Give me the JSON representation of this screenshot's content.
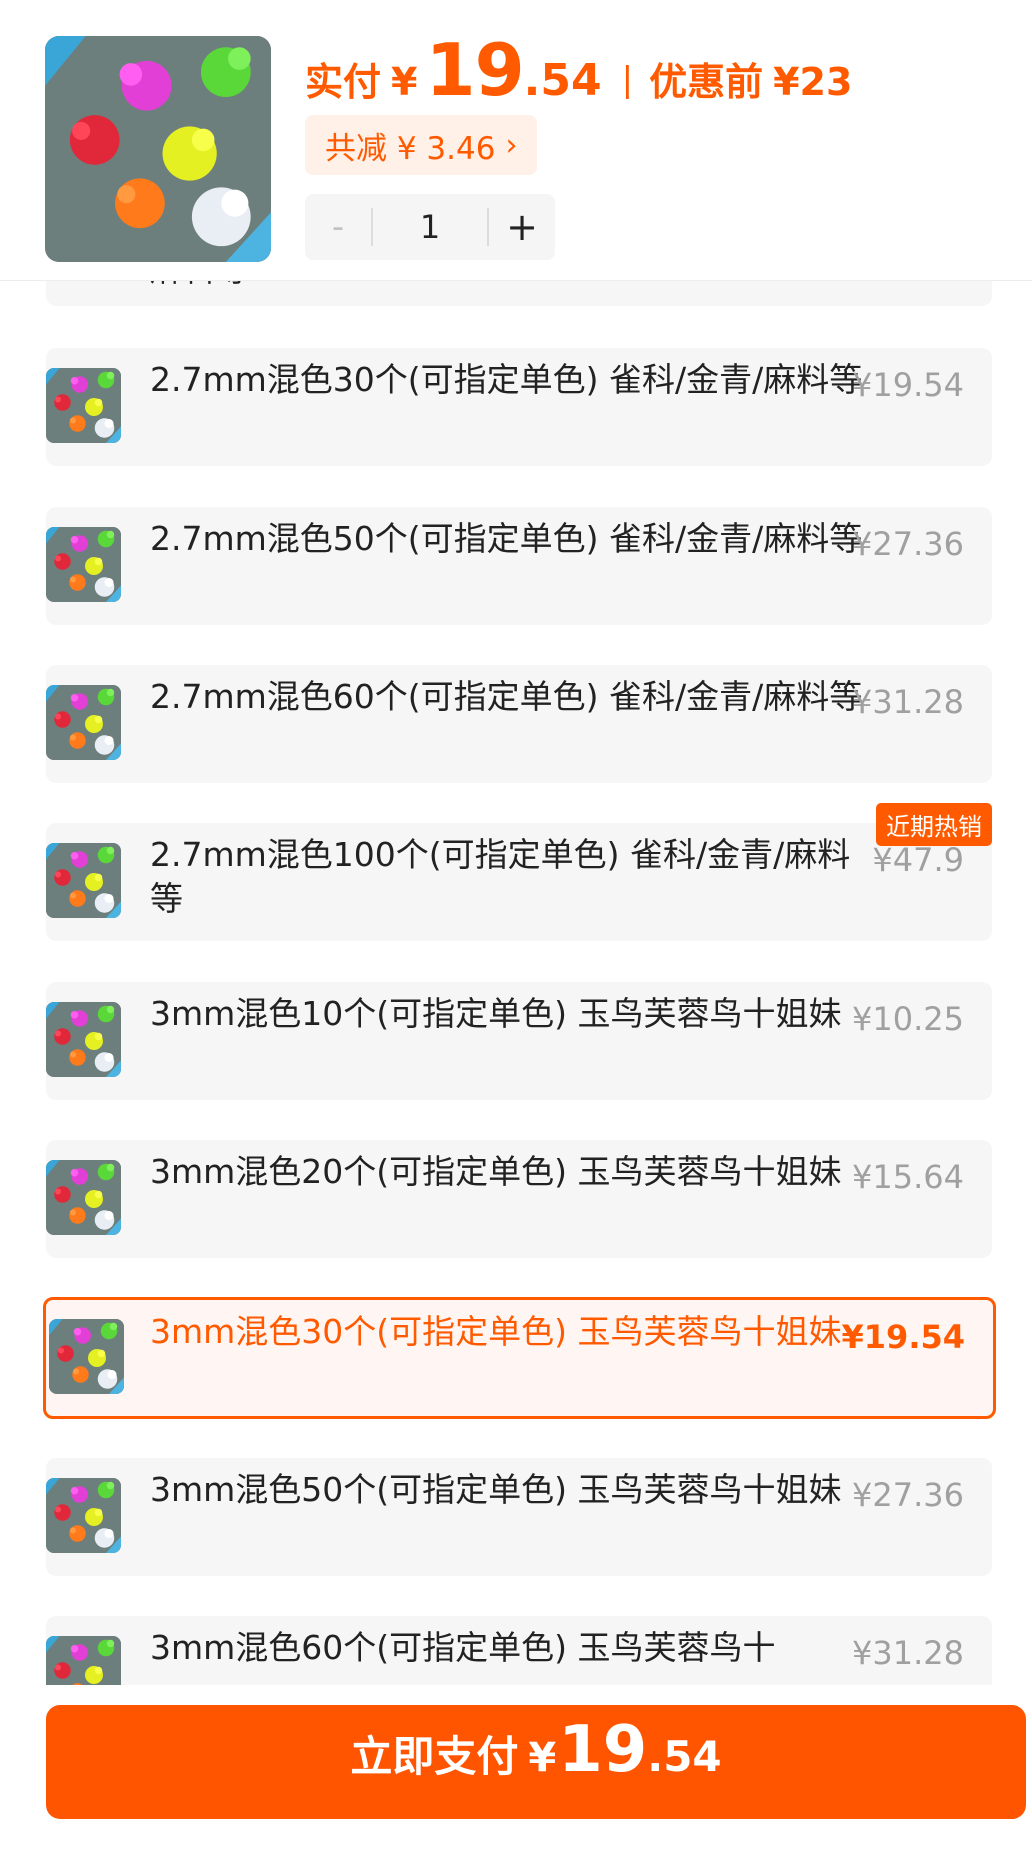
{
  "header": {
    "paid_label": "实付",
    "currency": "¥",
    "price_int": "19",
    "price_dec": ".54",
    "separator": "|",
    "original_label": "优惠前",
    "original_price": "¥23",
    "discount_text": "共减 ¥ 3.46",
    "discount_arrow": "›",
    "quantity": "1",
    "minus": "-",
    "plus": "+",
    "product_image": "bird-rings-photo"
  },
  "options": [
    {
      "text": "麻料等",
      "price": "",
      "state": "partial-top"
    },
    {
      "text": "2.7mm混色30个(可指定单色) 雀科/金青/麻料等",
      "price": "¥19.54"
    },
    {
      "text": "2.7mm混色50个(可指定单色) 雀科/金青/麻料等",
      "price": "¥27.36"
    },
    {
      "text": "2.7mm混色60个(可指定单色) 雀科/金青/麻料等",
      "price": "¥31.28"
    },
    {
      "text": "2.7mm混色100个(可指定单色) 雀科/金青/麻料等",
      "price": "¥47.9",
      "badge": "近期热销"
    },
    {
      "text": "3mm混色10个(可指定单色) 玉鸟芙蓉鸟十姐妹",
      "price": "¥10.25"
    },
    {
      "text": "3mm混色20个(可指定单色) 玉鸟芙蓉鸟十姐妹",
      "price": "¥15.64"
    },
    {
      "text": "3mm混色30个(可指定单色) 玉鸟芙蓉鸟十姐妹",
      "price": "¥19.54",
      "selected": true
    },
    {
      "text": "3mm混色50个(可指定单色) 玉鸟芙蓉鸟十姐妹",
      "price": "¥27.36"
    },
    {
      "text": "3mm混色60个(可指定单色) 玉鸟芙蓉鸟十",
      "price": "¥31.28",
      "state": "partial-bottom"
    }
  ],
  "pay": {
    "label": "立即支付",
    "currency": "¥",
    "price_int": "19",
    "price_dec": ".54"
  },
  "colors": {
    "accent": "#ff5a00",
    "pay_button": "#ff5500",
    "option_bg": "#f6f6f6",
    "selected_bg": "#fff6f3",
    "muted_price": "#a0a0a0"
  }
}
